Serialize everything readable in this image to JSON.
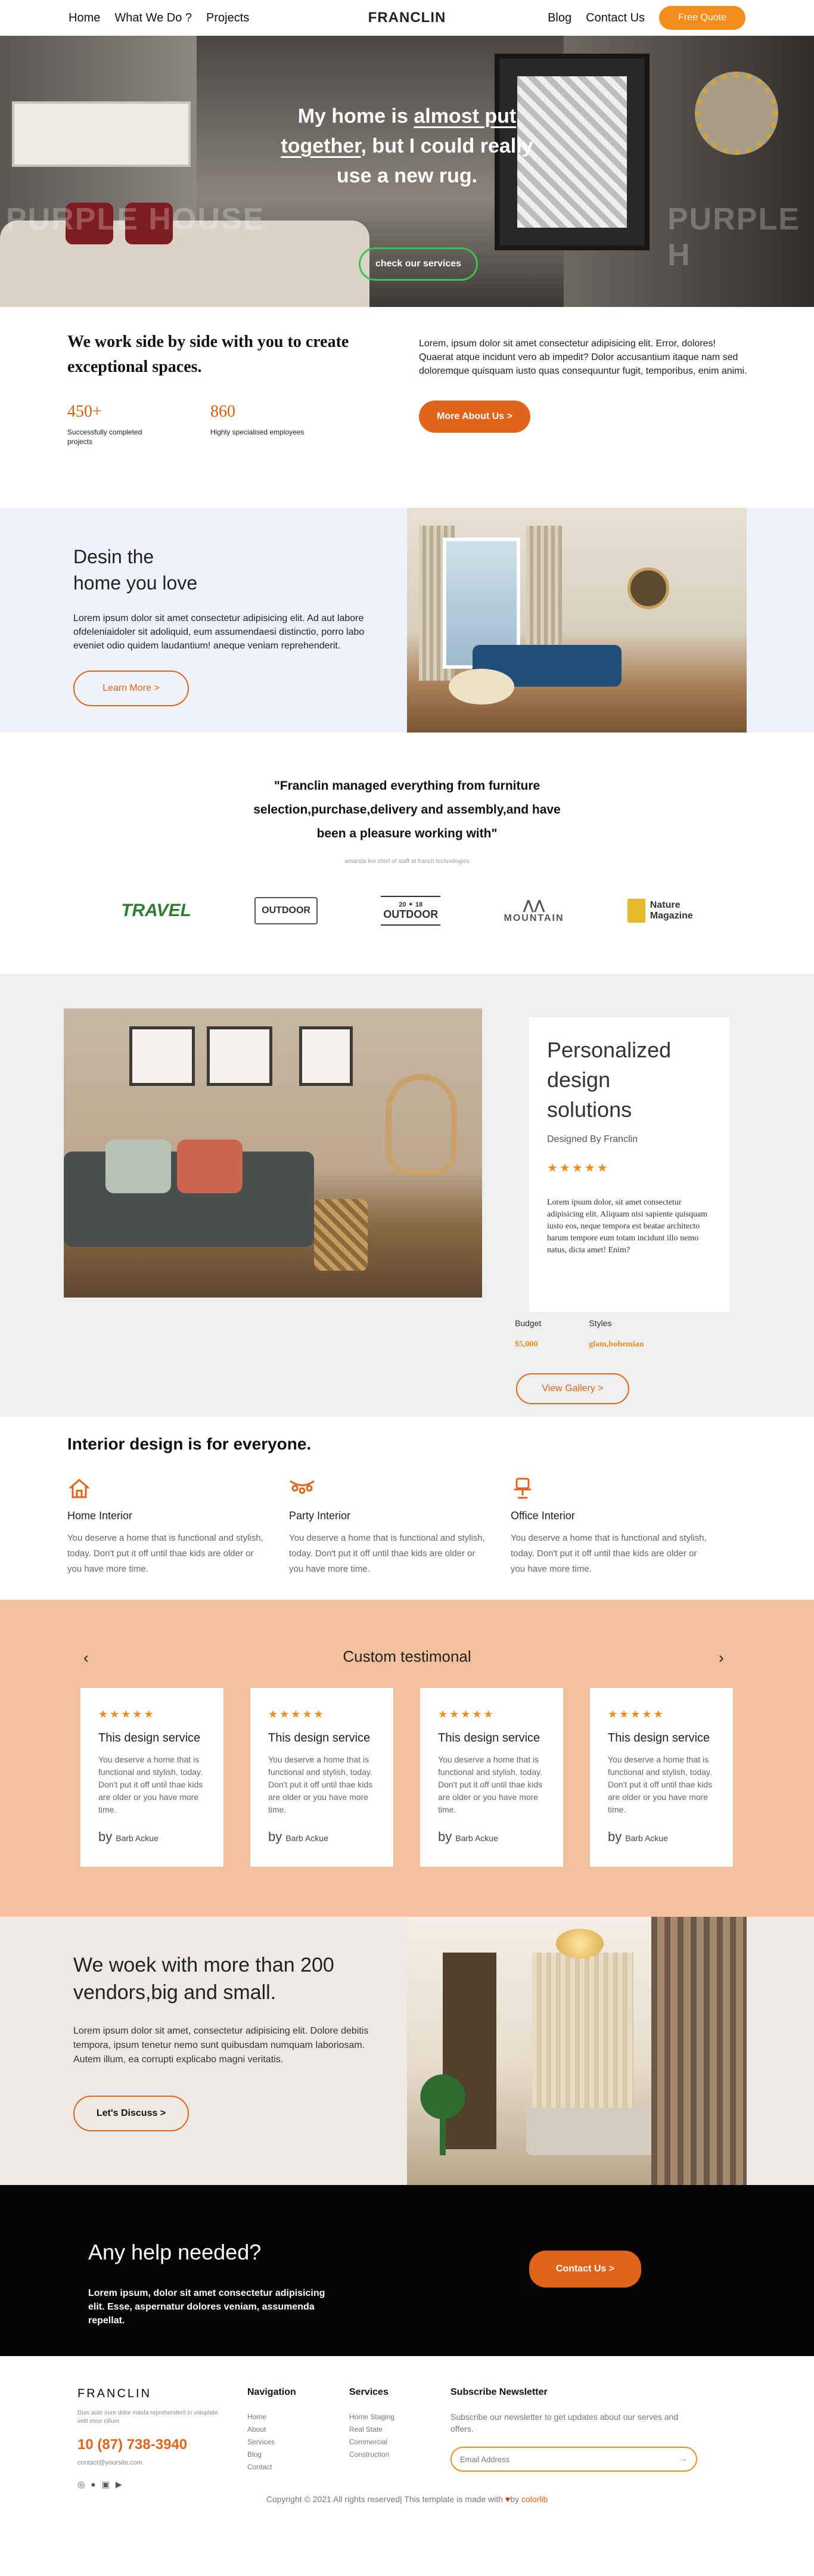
{
  "nav": {
    "links_left": [
      "Home",
      "What We Do ?",
      "Projects"
    ],
    "brand": "FRANCLIN",
    "links_right": [
      "Blog",
      "Contact Us"
    ],
    "quote_button": "Free Quote"
  },
  "hero": {
    "line1_pre": "My home is ",
    "line1_u": "almost put",
    "line2_u": "together",
    "line2_post": ", but I could really",
    "line3": "use a new rug.",
    "watermark_left": "PURPLE HOUSE",
    "watermark_right": "PURPLE H",
    "cta": "check our services"
  },
  "about": {
    "heading": "We work side by side with you to create exceptional spaces.",
    "stats": [
      {
        "value": "450+",
        "label": "Successfully completed projects"
      },
      {
        "value": "860",
        "label": "Highly specialised employees"
      }
    ],
    "paragraph": "Lorem, ipsum dolor sit amet consectetur adipisicing elit. Error, dolores! Quaerat atque incidunt vero ab impedit? Dolor accusantium itaque nam sed doloremque quisquam iusto quas consequuntur fugit, temporibus, enim animi.",
    "button": "More About Us >"
  },
  "design": {
    "heading_line1": "Desin the",
    "heading_line2": "home you love",
    "paragraph": "Lorem ipsum dolor sit amet consectetur adipisicing elit. Ad aut labore ofdeleniaidoler sit adoliquid, eum assumendaesi distinctio, porro labo eveniet odio quidem laudantium! aneque veniam reprehenderit.",
    "button": "Learn More >"
  },
  "quote": {
    "text": "\"Franclin managed everything from furniture selection,purchase,delivery and assembly,and have been a pleasure working with\"",
    "attribution": "amanda lee chief of staff at franch technologies"
  },
  "logos": {
    "travel": "TRAVEL",
    "outdoor1": "OUTDOOR",
    "outdoor2_year_l": "20",
    "outdoor2_year_r": "18",
    "outdoor2": "OUTDOOR",
    "mountain": "MOUNTAIN",
    "nature_line1": "Nature",
    "nature_line2": "Magazine"
  },
  "personal": {
    "title_line1": "Personalized",
    "title_line2": "design",
    "title_line3": "solutions",
    "by": "Designed By Franclin",
    "stars": "★★★★★",
    "paragraph": "Lorem ipsum dolor, sit amet consectetur adipisicing elit. Aliquam nisi sapiente quisquam iusto eos, neque tempora est beatae architecto harum tempore eum totam incidunt illo nemo natus, dicta amet! Enim?",
    "budget_label": "Budget",
    "budget_value": "$5,000",
    "styles_label": "Styles",
    "styles_value": "glam,bohemian",
    "gallery_button": "View Gallery >"
  },
  "everyone": {
    "heading": "Interior design is for everyone.",
    "features": [
      {
        "icon": "home-icon",
        "title": "Home Interior",
        "text": "You deserve a home that is functional and stylish, today. Don't put it off until thae kids are older or you have more time."
      },
      {
        "icon": "party-lights-icon",
        "title": "Party Interior",
        "text": "You deserve a home that is functional and stylish, today. Don't put it off until thae kids are older or you have more time."
      },
      {
        "icon": "office-chair-icon",
        "title": "Office Interior",
        "text": "You deserve a home that is functional and stylish, today. Don't put it off until thae kids are older or you have more time."
      }
    ]
  },
  "testimonials": {
    "heading": "Custom testimonal",
    "prev": "‹",
    "next": "›",
    "cards": [
      {
        "stars": "★★★★★",
        "title": "This design service",
        "text": "You deserve a home that is functional and stylish, today. Don't put it off until thae kids are older or you have more time.",
        "by": "by",
        "author": "Barb Ackue"
      },
      {
        "stars": "★★★★★",
        "title": "This design service",
        "text": "You deserve a home that is functional and stylish, today. Don't put it off until thae kids are older or you have more time.",
        "by": "by",
        "author": "Barb Ackue"
      },
      {
        "stars": "★★★★★",
        "title": "This design service",
        "text": "You deserve a home that is functional and stylish, today. Don't put it off until thae kids are older or you have more time.",
        "by": "by",
        "author": "Barb Ackue"
      },
      {
        "stars": "★★★★★",
        "title": "This design service",
        "text": "You deserve a home that is functional and stylish, today. Don't put it off until thae kids are older or you have more time.",
        "by": "by",
        "author": "Barb Ackue"
      }
    ]
  },
  "vendors": {
    "heading": "We woek with more than 200 vendors,big and small.",
    "paragraph": "Lorem ipsum dolor sit amet, consectetur adipisicing elit. Dolore debitis tempora, ipsum tenetur nemo sunt quibusdam numquam laboriosam. Autem illum, ea corrupti explicabo magni veritatis.",
    "button": "Let's Discuss >"
  },
  "help": {
    "heading": "Any help needed?",
    "paragraph": "Lorem ipsum, dolor sit amet consectetur adipisicing elit. Esse, aspernatur dolores veniam, assumenda repellat.",
    "button": "Contact Us >"
  },
  "footer": {
    "brand": "FRANCLIN",
    "desc": "Duis aute irure dolor inasfa reprehenderit in voluptate velit esse cillum",
    "phone": "10 (87) 738-3940",
    "email": "contact@yoursite.com",
    "nav_title": "Navigation",
    "nav_items": [
      "Home",
      "About",
      "Services",
      "Blog",
      "Contact"
    ],
    "services_title": "Services",
    "services_items": [
      "Home Staging",
      "Real State",
      "Commercial",
      "Construction"
    ],
    "newsletter_title": "Subscribe Newsletter",
    "newsletter_desc": "Subscribe our newsletter to get updates about our serves and offers.",
    "email_placeholder": "Email Address",
    "copyright_pre": "Copyright © 2021 All rights reserved| This template is made with ",
    "copyright_by": "by ",
    "copyright_link": "colorlib"
  },
  "colors": {
    "accent": "#e2641a",
    "quote_button": "#f28c1b",
    "hero_cta_border": "#3fbf58",
    "testimonial_bg": "#f2c09b"
  }
}
